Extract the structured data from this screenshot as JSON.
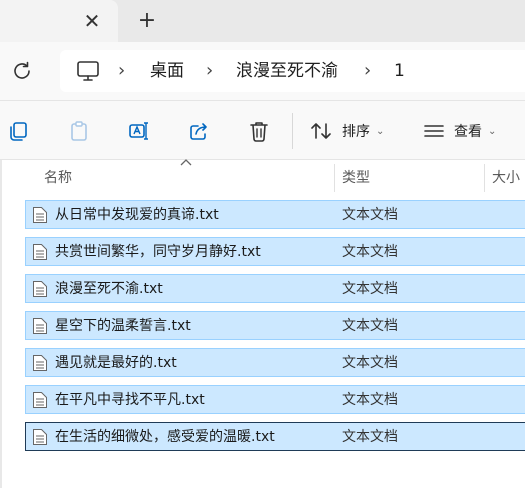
{
  "tabs": {
    "close_glyph": "✕",
    "new_glyph": "+"
  },
  "address": {
    "icons": [
      "refresh-icon",
      "this-pc-icon"
    ],
    "separator": "›",
    "crumbs": [
      "桌面",
      "浪漫至死不渝",
      "1"
    ]
  },
  "toolbar": {
    "icons": [
      "copy-icon",
      "paste-icon",
      "rename-icon",
      "share-icon",
      "delete-icon"
    ],
    "sort_label": "排序",
    "view_label": "查看",
    "chevron": "⌄"
  },
  "columns": {
    "name": "名称",
    "type": "类型",
    "size": "大小"
  },
  "files": [
    {
      "name": "从日常中发现爱的真谛.txt",
      "type": "文本文档"
    },
    {
      "name": "共赏世间繁华，同守岁月静好.txt",
      "type": "文本文档"
    },
    {
      "name": "浪漫至死不渝.txt",
      "type": "文本文档"
    },
    {
      "name": "星空下的温柔誓言.txt",
      "type": "文本文档"
    },
    {
      "name": "遇见就是最好的.txt",
      "type": "文本文档"
    },
    {
      "name": "在平凡中寻找不平凡.txt",
      "type": "文本文档"
    },
    {
      "name": "在生活的细微处，感受爱的温暖.txt",
      "type": "文本文档"
    }
  ],
  "colors": {
    "selection": "#cce8ff",
    "selection_border": "#99d1ff",
    "focus_border": "#1f3b57"
  }
}
